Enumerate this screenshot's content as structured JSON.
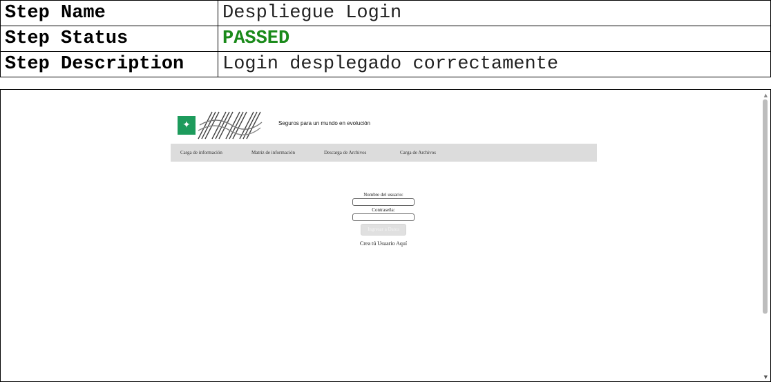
{
  "report": {
    "rows": [
      {
        "key": "Step Name",
        "value": "Despliegue Login"
      },
      {
        "key": "Step Status",
        "value": "PASSED"
      },
      {
        "key": "Step Description",
        "value": "Login desplegado correctamente"
      }
    ]
  },
  "screenshot": {
    "tagline": "Seguros para un mundo en evolución",
    "nav": [
      "Carga de información",
      "Matriz de información",
      "Descarga de Archivos",
      "Carga de Archivos"
    ],
    "login": {
      "username_label": "Nombre del usuario:",
      "username_value": "",
      "password_label": "Contraseña:",
      "password_value": "",
      "submit_label": "Ingresar a Datos",
      "create_prefix": "Crea tú Usuario",
      "create_link": "Aquí"
    },
    "colors": {
      "status_passed": "#1a8a1a",
      "nav_background": "#dcdcdc",
      "logo_green": "#1d9b5c"
    },
    "icons": [
      "bnp-star-logo",
      "brand-swirl-logo"
    ]
  }
}
